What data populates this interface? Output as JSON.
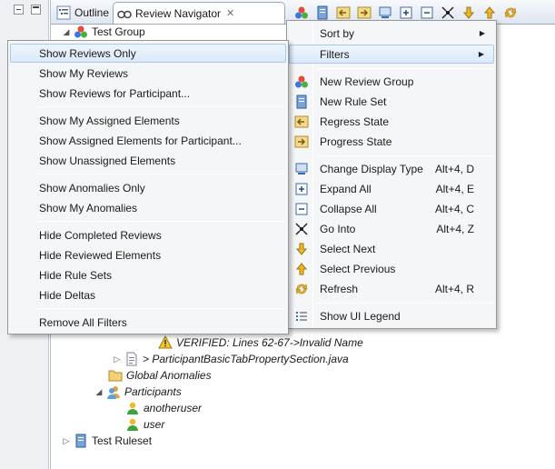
{
  "tabs": {
    "outline": "Outline",
    "review_navigator": "Review Navigator",
    "close_symbol": "✕"
  },
  "toolbar_icons": [
    "review-group-icon",
    "rule-set-icon",
    "regress-icon",
    "progress-icon",
    "display-type-icon",
    "expand-all-icon",
    "collapse-all-icon",
    "go-into-icon",
    "select-next-icon",
    "select-previous-icon",
    "refresh-icon"
  ],
  "tree": {
    "test_group": "Test Group",
    "verified": "VERIFIED: Lines 62-67->Invalid Name",
    "java_file": "> ParticipantBasicTabPropertySection.java",
    "global_anomalies": "Global Anomalies",
    "participants": "Participants",
    "anotheruser": "anotheruser",
    "user": "user",
    "test_ruleset": "Test Ruleset"
  },
  "context_menu": {
    "items": [
      {
        "label": "Sort by",
        "submenu": true
      },
      {
        "label": "Filters",
        "submenu": true,
        "highlighted": true
      },
      {
        "label": "New Review Group",
        "icon": "review-group-icon"
      },
      {
        "label": "New Rule Set",
        "icon": "rule-set-icon"
      },
      {
        "label": "Regress State",
        "icon": "regress-icon"
      },
      {
        "label": "Progress State",
        "icon": "progress-icon"
      },
      {
        "label": "Change Display Type",
        "icon": "display-type-icon",
        "accel": "Alt+4, D"
      },
      {
        "label": "Expand All",
        "icon": "expand-all-icon",
        "accel": "Alt+4, E"
      },
      {
        "label": "Collapse All",
        "icon": "collapse-all-icon",
        "accel": "Alt+4, C"
      },
      {
        "label": "Go Into",
        "icon": "go-into-icon",
        "accel": "Alt+4, Z"
      },
      {
        "label": "Select Next",
        "icon": "select-next-icon"
      },
      {
        "label": "Select Previous",
        "icon": "select-previous-icon"
      },
      {
        "label": "Refresh",
        "icon": "refresh-icon",
        "accel": "Alt+4, R"
      },
      {
        "label": "Show UI Legend",
        "icon": "legend-icon"
      }
    ]
  },
  "filters_menu": {
    "items": [
      {
        "label": "Show Reviews Only",
        "highlighted": true
      },
      {
        "label": "Show My Reviews"
      },
      {
        "label": "Show Reviews for Participant..."
      },
      {
        "label": "Show My Assigned Elements"
      },
      {
        "label": "Show Assigned Elements for Participant..."
      },
      {
        "label": "Show Unassigned Elements"
      },
      {
        "label": "Show Anomalies Only"
      },
      {
        "label": "Show My Anomalies"
      },
      {
        "label": "Hide Completed Reviews"
      },
      {
        "label": "Hide Reviewed Elements"
      },
      {
        "label": "Hide Rule Sets"
      },
      {
        "label": "Hide Deltas"
      },
      {
        "label": "Remove All Filters"
      }
    ]
  },
  "colors": {
    "highlight_border": "#a8c9ee",
    "menu_bg": "#f5f6f7",
    "tab_bar": "#dfe6f1"
  }
}
